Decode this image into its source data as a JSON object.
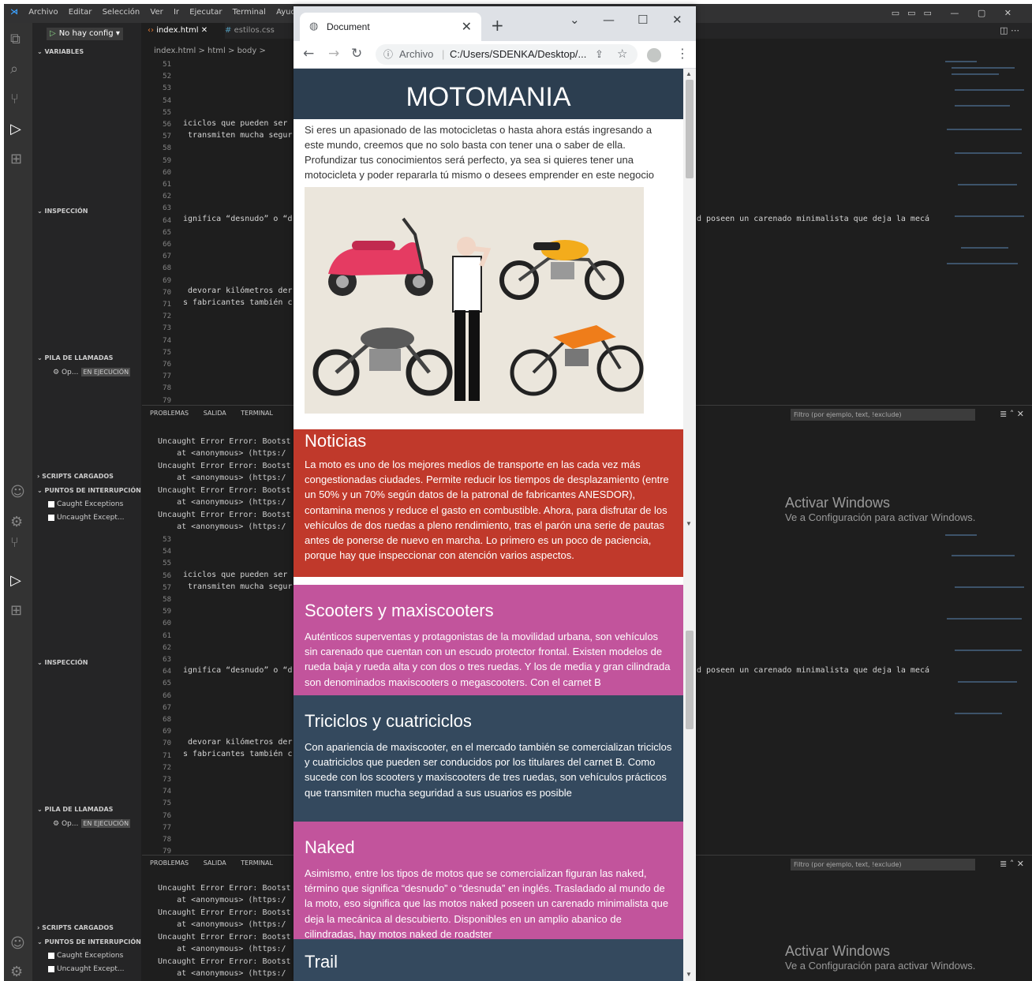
{
  "vscode": {
    "menu": [
      "Archivo",
      "Editar",
      "Selección",
      "Ver",
      "Ir",
      "Ejecutar",
      "Terminal",
      "Ayuda"
    ],
    "debug_config": "No hay config",
    "tabs": [
      "index.html",
      "estilos.css"
    ],
    "breadcrumb": "index.html > html > body >",
    "sections": {
      "variables": "VARIABLES",
      "inspeccion": "INSPECCIÓN",
      "pila": "PILA DE LLAMADAS",
      "pila_item": "Op...",
      "running": "EN EJECUCIÓN",
      "scripts": "SCRIPTS CARGADOS",
      "puntos": "PUNTOS DE INTERRUPCIÓN",
      "caught": "Caught Exceptions",
      "uncaught": "Uncaught Except..."
    },
    "line_numbers": [
      "51",
      "52",
      "53",
      "54",
      "55",
      "56",
      "57",
      "58",
      "59",
      "60",
      "61",
      "62",
      "63",
      "64",
      "65",
      "66",
      "67",
      "68",
      "69",
      "70",
      "71",
      "72",
      "73",
      "74",
      "75",
      "76",
      "77",
      "78",
      "79"
    ],
    "line_numbers_bottom": [
      "53",
      "54",
      "55",
      "56",
      "57",
      "58",
      "59",
      "60",
      "61",
      "62",
      "63",
      "64",
      "65",
      "66",
      "67",
      "68",
      "69",
      "70",
      "71",
      "72",
      "73",
      "74",
      "75",
      "76",
      "77",
      "78",
      "79"
    ],
    "code": {
      "l56": "iciclos que pueden ser",
      "l57": " transmiten mucha segur",
      "l64": "ignifica “desnudo” o “d",
      "l64_right": "d poseen un carenado minimalista que deja la mecá",
      "l70": " devorar kilómetros der",
      "l71": "s fabricantes también c"
    },
    "panel_tabs": [
      "PROBLEMAS",
      "SALIDA",
      "TERMINAL"
    ],
    "filter_placeholder": "Filtro (por ejemplo, text, !exclude)",
    "errors": [
      "Uncaught Error Error: Bootst",
      "    at <anonymous> (https:/"
    ],
    "activate_title": "Activar Windows",
    "activate_sub": "Ve a Configuración para activar Windows."
  },
  "browser": {
    "tab_title": "Document",
    "scheme": "Archivo",
    "url": "C:/Users/SDENKA/Desktop/...",
    "page": {
      "title": "MOTOMANIA",
      "intro": "Si eres un apasionado de las motocicletas o hasta ahora estás ingresando a este mundo, creemos que no solo basta con tener una o saber de ella. Profundizar tus conocimientos será perfecto, ya sea si quieres tener una motocicleta y poder repararla tú mismo o desees emprender en este negocio",
      "sections": [
        {
          "title": "Noticias",
          "color": "#c0392b",
          "text": "La moto es uno de los mejores medios de transporte en las cada vez más congestionadas ciudades. Permite reducir los tiempos de desplazamiento (entre un 50% y un 70% según datos de la patronal de fabricantes ANESDOR), contamina menos y reduce el gasto en combustible. Ahora, para disfrutar de los vehículos de dos ruedas a pleno rendimiento, tras el parón una serie de pautas antes de ponerse de nuevo en marcha. Lo primero es un poco de paciencia, porque hay que inspeccionar con atención varios aspectos."
        },
        {
          "title": "Scooters y maxiscooters",
          "color": "#c2549c",
          "text": "Auténticos superventas y protagonistas de la movilidad urbana, son vehículos sin carenado que cuentan con un escudo protector frontal. Existen modelos de rueda baja y rueda alta y con dos o tres ruedas. Y los de media y gran cilindrada son denominados maxiscooters o megascooters. Con el carnet B"
        },
        {
          "title": "Triciclos y cuatriciclos",
          "color": "#34495e",
          "text": "Con apariencia de maxiscooter, en el mercado también se comercializan triciclos y cuatriciclos que pueden ser conducidos por los titulares del carnet B. Como sucede con los scooters y maxiscooters de tres ruedas, son vehículos prácticos que transmiten mucha seguridad a sus usuarios es posible"
        },
        {
          "title": "Naked",
          "color": "#c2549c",
          "text": "Asimismo, entre los tipos de motos que se comercializan figuran las naked, término que significa “desnudo” o “desnuda” en inglés. Trasladado al mundo de la moto, eso significa que las motos naked poseen un carenado minimalista que deja la mecánica al descubierto. Disponibles en un amplio abanico de cilindradas, hay motos naked de roadster"
        },
        {
          "title": "Trail",
          "color": "#34495e",
          "text": ""
        }
      ]
    }
  }
}
